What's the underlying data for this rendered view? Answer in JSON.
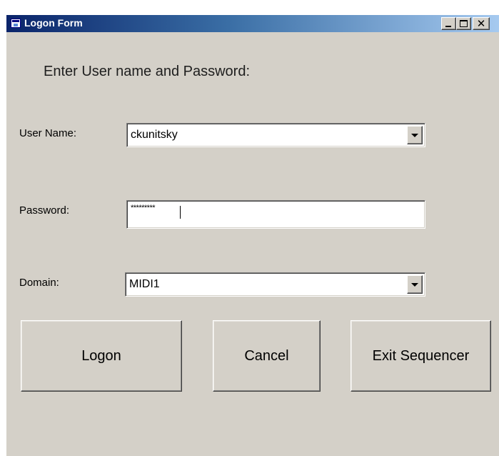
{
  "window": {
    "title": "Logon Form",
    "controls": {
      "minimize": "minimize",
      "maximize": "maximize",
      "close": "✕"
    }
  },
  "form": {
    "heading": "Enter User name and Password:",
    "user_name": {
      "label": "User Name:",
      "value": "ckunitsky"
    },
    "password": {
      "label": "Password:",
      "value": "*********"
    },
    "domain": {
      "label": "Domain:",
      "value": "MIDI1"
    }
  },
  "buttons": {
    "logon": "Logon",
    "cancel": "Cancel",
    "exit": "Exit Sequencer"
  },
  "icons": {
    "app": "app-window-icon",
    "dropdown": "chevron-down-icon"
  },
  "colors": {
    "window_bg": "#d4d0c8",
    "titlebar_start": "#0a246a",
    "titlebar_end": "#a6caf0"
  }
}
